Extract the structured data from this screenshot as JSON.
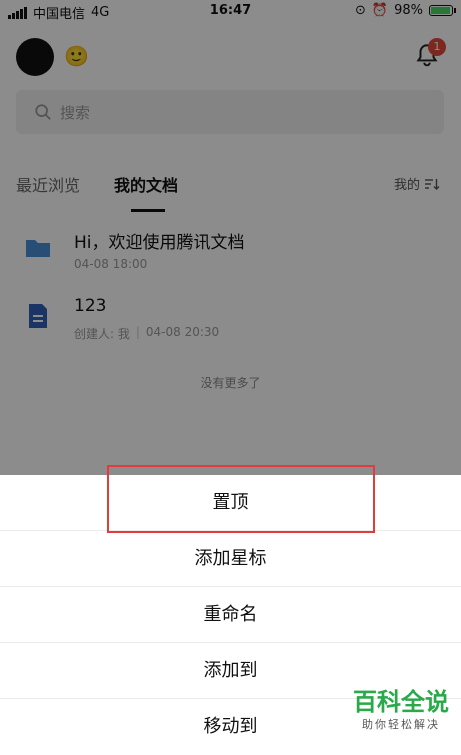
{
  "status_bar": {
    "carrier": "中国电信",
    "network": "4G",
    "time": "16:47",
    "battery_text": "98%",
    "battery_level": 0.98
  },
  "header": {
    "notification_count": "1",
    "colors": {
      "badge": "#e24a3b"
    }
  },
  "search": {
    "placeholder": "搜索"
  },
  "tabs": [
    {
      "label": "最近浏览",
      "active": false
    },
    {
      "label": "我的文档",
      "active": true
    }
  ],
  "sort": {
    "label": "我的"
  },
  "documents": [
    {
      "title": "Hi，欢迎使用腾讯文档",
      "icon": "folder-icon",
      "meta": [
        "04-08 18:00"
      ]
    },
    {
      "title": "123",
      "icon": "doc-icon",
      "meta": [
        "创建人: 我",
        "04-08 20:30"
      ]
    }
  ],
  "list_end_text": "没有更多了",
  "action_sheet": {
    "items": [
      {
        "label": "置顶",
        "highlighted": true
      },
      {
        "label": "添加星标"
      },
      {
        "label": "重命名"
      },
      {
        "label": "添加到"
      },
      {
        "label": "移动到"
      }
    ]
  },
  "watermark": {
    "brand": "百科全说",
    "tagline": "助你轻松解决"
  },
  "colors": {
    "overlay": "rgba(0,0,0,0.45)",
    "highlight_border": "#e23b3b",
    "folder_blue": "#4a8fd6",
    "doc_blue": "#2f5fb8",
    "watermark_green": "#2aa84a"
  }
}
